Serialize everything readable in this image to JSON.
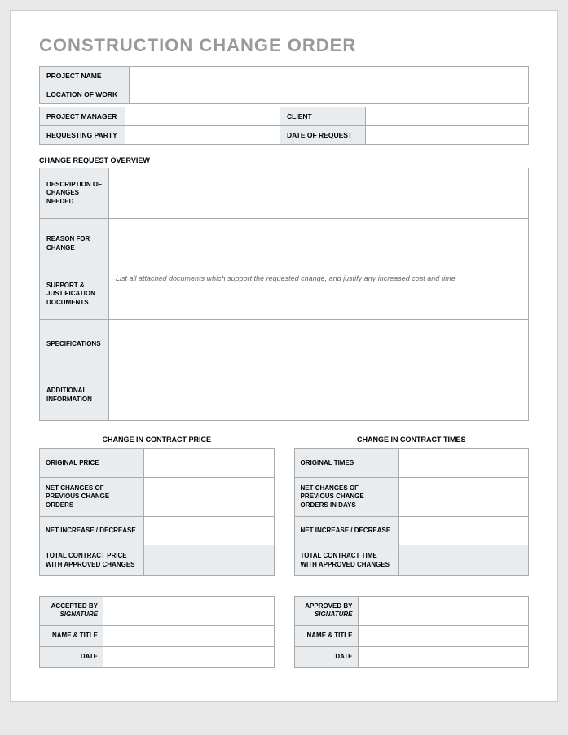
{
  "title": "CONSTRUCTION CHANGE ORDER",
  "head": {
    "project_name_label": "PROJECT NAME",
    "project_name_value": "",
    "location_label": "LOCATION OF WORK",
    "location_value": "",
    "pm_label": "PROJECT MANAGER",
    "pm_value": "",
    "client_label": "CLIENT",
    "client_value": "",
    "requesting_label": "REQUESTING PARTY",
    "requesting_value": "",
    "date_request_label": "DATE OF REQUEST",
    "date_request_value": ""
  },
  "overview": {
    "header": "CHANGE REQUEST OVERVIEW",
    "desc_label": "DESCRIPTION OF CHANGES NEEDED",
    "desc_value": "",
    "reason_label": "REASON FOR CHANGE",
    "reason_value": "",
    "support_label": "SUPPORT & JUSTIFICATION DOCUMENTS",
    "support_value": "List all attached documents which support the requested change, and justify any increased cost and time.",
    "spec_label": "SPECIFICATIONS",
    "spec_value": "",
    "addl_label": "ADDITIONAL INFORMATION",
    "addl_value": ""
  },
  "price": {
    "header": "CHANGE IN CONTRACT PRICE",
    "original_label": "ORIGINAL PRICE",
    "original_value": "",
    "netprev_label": "NET CHANGES OF PREVIOUS CHANGE ORDERS",
    "netprev_value": "",
    "netinc_label": "NET INCREASE / DECREASE",
    "netinc_value": "",
    "total_label": "TOTAL CONTRACT PRICE WITH APPROVED CHANGES",
    "total_value": ""
  },
  "times": {
    "header": "CHANGE IN CONTRACT TIMES",
    "original_label": "ORIGINAL TIMES",
    "original_value": "",
    "netprev_label": "NET CHANGES OF PREVIOUS CHANGE ORDERS IN DAYS",
    "netprev_value": "",
    "netinc_label": "NET INCREASE / DECREASE",
    "netinc_value": "",
    "total_label": "TOTAL CONTRACT TIME WITH APPROVED CHANGES",
    "total_value": ""
  },
  "accepted": {
    "by_label": "ACCEPTED BY",
    "sig_label": "SIGNATURE",
    "by_value": "",
    "name_label": "NAME & TITLE",
    "name_value": "",
    "date_label": "DATE",
    "date_value": ""
  },
  "approved": {
    "by_label": "APPROVED BY",
    "sig_label": "SIGNATURE",
    "by_value": "",
    "name_label": "NAME & TITLE",
    "name_value": "",
    "date_label": "DATE",
    "date_value": ""
  }
}
